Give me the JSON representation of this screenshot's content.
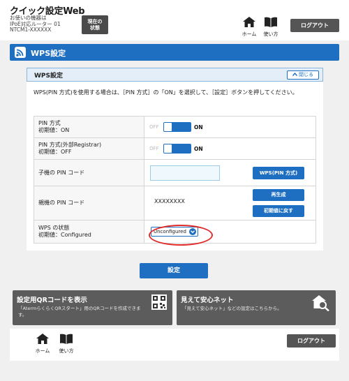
{
  "header": {
    "app_title": "クイック設定Web",
    "device_line1": "お使いの機器は",
    "device_line2": "IPoE対応ルーター 01",
    "device_line3": "NTCM1-XXXXXX",
    "status_button_line1": "現在の",
    "status_button_line2": "状態",
    "home_label": "ホーム",
    "help_label": "使い方",
    "logout_label": "ログアウト"
  },
  "section": {
    "title": "WPS設定"
  },
  "panel": {
    "title": "WPS設定",
    "close_label": "閉じる",
    "description": "WPS(PIN 方式)を使用する場合は、［PIN 方式］の「ON」を選択して、［設定］ボタンを押してください。",
    "rows": {
      "pin_method": {
        "label": "PIN 方式",
        "default": "初期値：ON",
        "off_label": "OFF",
        "on_label": "ON",
        "state": "ON"
      },
      "pin_registrar": {
        "label": "PIN 方式(外部Registrar)",
        "default": "初期値：OFF",
        "off_label": "OFF",
        "on_label": "ON",
        "state": "ON"
      },
      "child_pin": {
        "label": "子機の PIN コード",
        "input_value": "",
        "button_label": "WPS(PIN 方式)"
      },
      "parent_pin": {
        "label": "親機の PIN コード",
        "value": "XXXXXXXX",
        "regenerate_label": "再生成",
        "reset_label": "初期値に戻す"
      },
      "wps_status": {
        "label": "WPS の状態",
        "default": "初期値：Configured",
        "selected": "Unconfigured"
      }
    },
    "submit_label": "設定"
  },
  "promos": {
    "qr": {
      "title": "設定用QRコードを表示",
      "desc_line1": "「AtermらくらくQRスタート」用のQRコードを作成できま",
      "desc_line2": "す。"
    },
    "safety": {
      "title": "見えて安心ネット",
      "desc_line1": "「見えて安心ネット」などの設定はこちらから。"
    }
  },
  "footer": {
    "home_label": "ホーム",
    "help_label": "使い方",
    "logout_label": "ログアウト"
  },
  "colors": {
    "accent": "#1e6fc2",
    "highlight": "#e12b2b",
    "dark_button": "#555555",
    "promo_bg": "#5c5c5c"
  }
}
